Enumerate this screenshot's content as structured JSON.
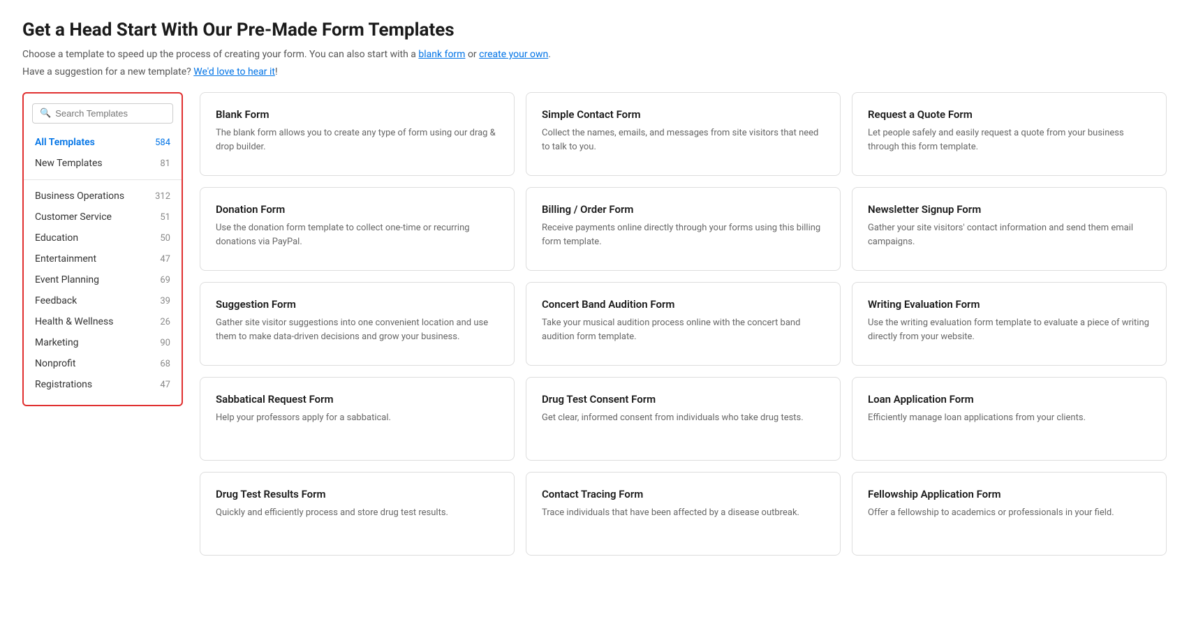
{
  "page": {
    "title": "Get a Head Start With Our Pre-Made Form Templates",
    "subtitle1": "Choose a template to speed up the process of creating your form. You can also start with a",
    "link1": "blank form",
    "subtitle_or": "or",
    "link2": "create your own",
    "subtitle2_prefix": "Have a suggestion for a new template?",
    "link3": "We'd love to hear it",
    "subtitle2_suffix": "!"
  },
  "sidebar": {
    "search_placeholder": "Search Templates",
    "items_top": [
      {
        "label": "All Templates",
        "count": "584",
        "active": true
      },
      {
        "label": "New Templates",
        "count": "81",
        "active": false
      }
    ],
    "categories": [
      {
        "label": "Business Operations",
        "count": "312"
      },
      {
        "label": "Customer Service",
        "count": "51"
      },
      {
        "label": "Education",
        "count": "50"
      },
      {
        "label": "Entertainment",
        "count": "47"
      },
      {
        "label": "Event Planning",
        "count": "69"
      },
      {
        "label": "Feedback",
        "count": "39"
      },
      {
        "label": "Health & Wellness",
        "count": "26"
      },
      {
        "label": "Marketing",
        "count": "90"
      },
      {
        "label": "Nonprofit",
        "count": "68"
      },
      {
        "label": "Registrations",
        "count": "47"
      }
    ]
  },
  "cards": [
    {
      "title": "Blank Form",
      "desc": "The blank form allows you to create any type of form using our drag & drop builder."
    },
    {
      "title": "Simple Contact Form",
      "desc": "Collect the names, emails, and messages from site visitors that need to talk to you."
    },
    {
      "title": "Request a Quote Form",
      "desc": "Let people safely and easily request a quote from your business through this form template."
    },
    {
      "title": "Donation Form",
      "desc": "Use the donation form template to collect one-time or recurring donations via PayPal."
    },
    {
      "title": "Billing / Order Form",
      "desc": "Receive payments online directly through your forms using this billing form template."
    },
    {
      "title": "Newsletter Signup Form",
      "desc": "Gather your site visitors' contact information and send them email campaigns."
    },
    {
      "title": "Suggestion Form",
      "desc": "Gather site visitor suggestions into one convenient location and use them to make data-driven decisions and grow your business."
    },
    {
      "title": "Concert Band Audition Form",
      "desc": "Take your musical audition process online with the concert band audition form template."
    },
    {
      "title": "Writing Evaluation Form",
      "desc": "Use the writing evaluation form template to evaluate a piece of writing directly from your website."
    },
    {
      "title": "Sabbatical Request Form",
      "desc": "Help your professors apply for a sabbatical."
    },
    {
      "title": "Drug Test Consent Form",
      "desc": "Get clear, informed consent from individuals who take drug tests."
    },
    {
      "title": "Loan Application Form",
      "desc": "Efficiently manage loan applications from your clients."
    },
    {
      "title": "Drug Test Results Form",
      "desc": "Quickly and efficiently process and store drug test results."
    },
    {
      "title": "Contact Tracing Form",
      "desc": "Trace individuals that have been affected by a disease outbreak."
    },
    {
      "title": "Fellowship Application Form",
      "desc": "Offer a fellowship to academics or professionals in your field."
    }
  ]
}
